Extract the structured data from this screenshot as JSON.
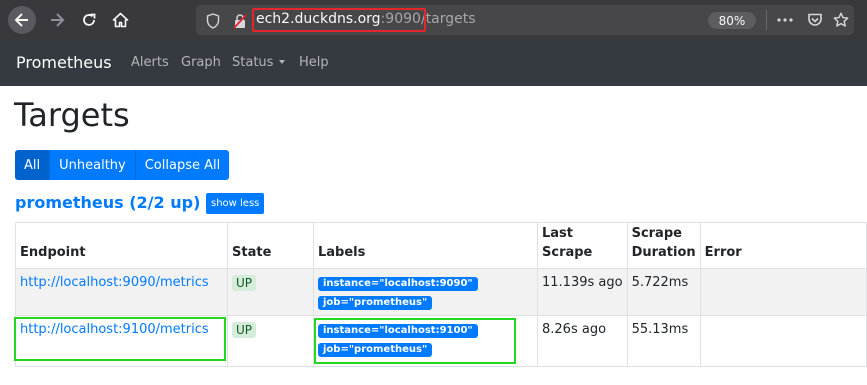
{
  "browser": {
    "url_host": "ech2.duckdns.org",
    "url_port": ":9090",
    "url_path": "/targets",
    "zoom": "80%"
  },
  "navbar": {
    "brand": "Prometheus",
    "links": [
      "Alerts",
      "Graph",
      "Status",
      "Help"
    ]
  },
  "page": {
    "title": "Targets",
    "filters": [
      "All",
      "Unhealthy",
      "Collapse All"
    ],
    "active_filter": "All"
  },
  "job": {
    "title": "prometheus (2/2 up)",
    "toggle_label": "show less"
  },
  "table": {
    "headers": [
      "Endpoint",
      "State",
      "Labels",
      "Last Scrape",
      "Scrape Duration",
      "Error"
    ],
    "rows": [
      {
        "endpoint": "http://localhost:9090/metrics",
        "state": "UP",
        "labels": [
          "instance=\"localhost:9090\"",
          "job=\"prometheus\""
        ],
        "last_scrape": "11.139s ago",
        "scrape_duration": "5.722ms",
        "error": ""
      },
      {
        "endpoint": "http://localhost:9100/metrics",
        "state": "UP",
        "labels": [
          "instance=\"localhost:9100\"",
          "job=\"prometheus\""
        ],
        "last_scrape": "8.26s ago",
        "scrape_duration": "55.13ms",
        "error": ""
      }
    ]
  },
  "colors": {
    "primary": "#007bff",
    "navbar": "#343a40",
    "browser_chrome": "#38383d",
    "highlight_red": "#e5262c",
    "highlight_green": "#24d820",
    "up_badge_bg": "#d4edda",
    "up_badge_text": "#155724"
  },
  "icons": {
    "back": "back-arrow-icon",
    "forward": "forward-arrow-icon",
    "reload": "reload-icon",
    "home": "home-icon",
    "page_info": "page-info-icon",
    "insecure": "insecure-lock-icon",
    "menu": "more-menu-icon",
    "pocket": "pocket-icon",
    "bookmark": "bookmark-star-icon"
  }
}
